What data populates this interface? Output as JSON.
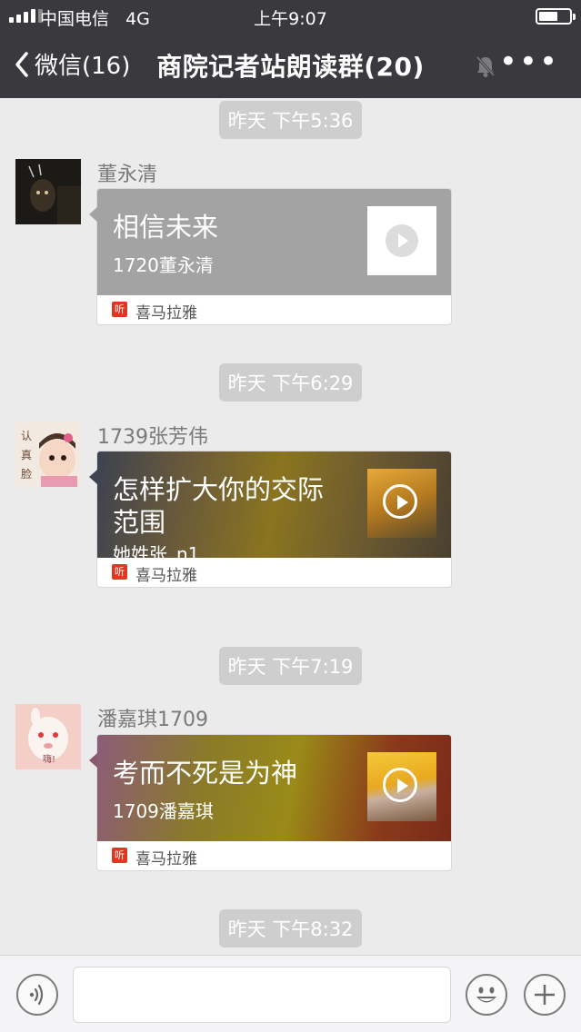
{
  "status_bar": {
    "carrier": "中国电信",
    "network": "4G",
    "time": "上午9:07",
    "battery_level": 0.5
  },
  "nav": {
    "back_label": "微信(16)",
    "title": "商院记者站朗读群(20)"
  },
  "messages": [
    {
      "timestamp": "昨天 下午5:36",
      "sender": "董永清",
      "card": {
        "title": "相信未来",
        "subtitle": "1720董永清",
        "source": "喜马拉雅",
        "source_icon": "听"
      }
    },
    {
      "timestamp": "昨天 下午6:29",
      "sender": "1739张芳伟",
      "card": {
        "title": "怎样扩大你的交际范围",
        "subtitle": "她姓张_n1",
        "source": "喜马拉雅",
        "source_icon": "听"
      }
    },
    {
      "timestamp": "昨天 下午7:19",
      "sender": "潘嘉琪1709",
      "card": {
        "title": "考而不死是为神",
        "subtitle": "1709潘嘉琪",
        "source": "喜马拉雅",
        "source_icon": "听"
      }
    },
    {
      "timestamp": "昨天 下午8:32"
    }
  ],
  "avatar_texts": {
    "second": "认真脸",
    "third": "嗨!"
  },
  "colors": {
    "nav_bg": "#3a3a3e",
    "chat_bg": "#ebebeb",
    "source_red": "#e0351f"
  }
}
